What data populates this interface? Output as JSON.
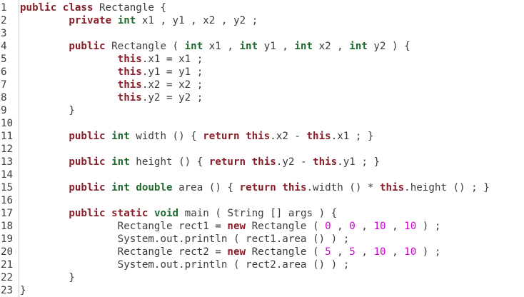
{
  "editor": {
    "lines": [
      {
        "n": "1",
        "tokens": [
          {
            "t": "kw",
            "v": "public"
          },
          {
            "t": "pl",
            "v": " "
          },
          {
            "t": "kw",
            "v": "class"
          },
          {
            "t": "pl",
            "v": " Rectangle {"
          }
        ]
      },
      {
        "n": "2",
        "tokens": [
          {
            "t": "pl",
            "v": "        "
          },
          {
            "t": "kw",
            "v": "private"
          },
          {
            "t": "pl",
            "v": " "
          },
          {
            "t": "ty",
            "v": "int"
          },
          {
            "t": "pl",
            "v": " x1 , y1 , x2 , y2 ;"
          }
        ]
      },
      {
        "n": "3",
        "tokens": []
      },
      {
        "n": "4",
        "tokens": [
          {
            "t": "pl",
            "v": "        "
          },
          {
            "t": "kw",
            "v": "public"
          },
          {
            "t": "pl",
            "v": " Rectangle ( "
          },
          {
            "t": "ty",
            "v": "int"
          },
          {
            "t": "pl",
            "v": " x1 , "
          },
          {
            "t": "ty",
            "v": "int"
          },
          {
            "t": "pl",
            "v": " y1 , "
          },
          {
            "t": "ty",
            "v": "int"
          },
          {
            "t": "pl",
            "v": " x2 , "
          },
          {
            "t": "ty",
            "v": "int"
          },
          {
            "t": "pl",
            "v": " y2 ) {"
          }
        ]
      },
      {
        "n": "5",
        "tokens": [
          {
            "t": "pl",
            "v": "                "
          },
          {
            "t": "kw",
            "v": "this"
          },
          {
            "t": "pl",
            "v": ".x1 = x1 ;"
          }
        ]
      },
      {
        "n": "6",
        "tokens": [
          {
            "t": "pl",
            "v": "                "
          },
          {
            "t": "kw",
            "v": "this"
          },
          {
            "t": "pl",
            "v": ".y1 = y1 ;"
          }
        ]
      },
      {
        "n": "7",
        "tokens": [
          {
            "t": "pl",
            "v": "                "
          },
          {
            "t": "kw",
            "v": "this"
          },
          {
            "t": "pl",
            "v": ".x2 = x2 ;"
          }
        ]
      },
      {
        "n": "8",
        "tokens": [
          {
            "t": "pl",
            "v": "                "
          },
          {
            "t": "kw",
            "v": "this"
          },
          {
            "t": "pl",
            "v": ".y2 = y2 ;"
          }
        ]
      },
      {
        "n": "9",
        "tokens": [
          {
            "t": "pl",
            "v": "        }"
          }
        ]
      },
      {
        "n": "10",
        "tokens": []
      },
      {
        "n": "11",
        "tokens": [
          {
            "t": "pl",
            "v": "        "
          },
          {
            "t": "kw",
            "v": "public"
          },
          {
            "t": "pl",
            "v": " "
          },
          {
            "t": "ty",
            "v": "int"
          },
          {
            "t": "pl",
            "v": " width () { "
          },
          {
            "t": "kw",
            "v": "return"
          },
          {
            "t": "pl",
            "v": " "
          },
          {
            "t": "kw",
            "v": "this"
          },
          {
            "t": "pl",
            "v": ".x2 - "
          },
          {
            "t": "kw",
            "v": "this"
          },
          {
            "t": "pl",
            "v": ".x1 ; }"
          }
        ]
      },
      {
        "n": "12",
        "tokens": []
      },
      {
        "n": "13",
        "tokens": [
          {
            "t": "pl",
            "v": "        "
          },
          {
            "t": "kw",
            "v": "public"
          },
          {
            "t": "pl",
            "v": " "
          },
          {
            "t": "ty",
            "v": "int"
          },
          {
            "t": "pl",
            "v": " height () { "
          },
          {
            "t": "kw",
            "v": "return"
          },
          {
            "t": "pl",
            "v": " "
          },
          {
            "t": "kw",
            "v": "this"
          },
          {
            "t": "pl",
            "v": ".y2 - "
          },
          {
            "t": "kw",
            "v": "this"
          },
          {
            "t": "pl",
            "v": ".y1 ; }"
          }
        ]
      },
      {
        "n": "14",
        "tokens": []
      },
      {
        "n": "15",
        "tokens": [
          {
            "t": "pl",
            "v": "        "
          },
          {
            "t": "kw",
            "v": "public"
          },
          {
            "t": "pl",
            "v": " "
          },
          {
            "t": "ty",
            "v": "int"
          },
          {
            "t": "pl",
            "v": " "
          },
          {
            "t": "ty",
            "v": "double"
          },
          {
            "t": "pl",
            "v": " area () { "
          },
          {
            "t": "kw",
            "v": "return"
          },
          {
            "t": "pl",
            "v": " "
          },
          {
            "t": "kw",
            "v": "this"
          },
          {
            "t": "pl",
            "v": ".width () * "
          },
          {
            "t": "kw",
            "v": "this"
          },
          {
            "t": "pl",
            "v": ".height () ; }"
          }
        ]
      },
      {
        "n": "16",
        "tokens": []
      },
      {
        "n": "17",
        "tokens": [
          {
            "t": "pl",
            "v": "        "
          },
          {
            "t": "kw",
            "v": "public"
          },
          {
            "t": "pl",
            "v": " "
          },
          {
            "t": "kw",
            "v": "static"
          },
          {
            "t": "pl",
            "v": " "
          },
          {
            "t": "ty",
            "v": "void"
          },
          {
            "t": "pl",
            "v": " main ( String [] args ) {"
          }
        ]
      },
      {
        "n": "18",
        "tokens": [
          {
            "t": "pl",
            "v": "                Rectangle rect1 = "
          },
          {
            "t": "kw",
            "v": "new"
          },
          {
            "t": "pl",
            "v": " Rectangle ( "
          },
          {
            "t": "num",
            "v": "0"
          },
          {
            "t": "pl",
            "v": " , "
          },
          {
            "t": "num",
            "v": "0"
          },
          {
            "t": "pl",
            "v": " , "
          },
          {
            "t": "num",
            "v": "10"
          },
          {
            "t": "pl",
            "v": " , "
          },
          {
            "t": "num",
            "v": "10"
          },
          {
            "t": "pl",
            "v": " ) ;"
          }
        ]
      },
      {
        "n": "19",
        "tokens": [
          {
            "t": "pl",
            "v": "                System.out.println ( rect1.area () ) ;"
          }
        ]
      },
      {
        "n": "20",
        "tokens": [
          {
            "t": "pl",
            "v": "                Rectangle rect2 = "
          },
          {
            "t": "kw",
            "v": "new"
          },
          {
            "t": "pl",
            "v": " Rectangle ( "
          },
          {
            "t": "num",
            "v": "5"
          },
          {
            "t": "pl",
            "v": " , "
          },
          {
            "t": "num",
            "v": "5"
          },
          {
            "t": "pl",
            "v": " , "
          },
          {
            "t": "num",
            "v": "10"
          },
          {
            "t": "pl",
            "v": " , "
          },
          {
            "t": "num",
            "v": "10"
          },
          {
            "t": "pl",
            "v": " ) ;"
          }
        ]
      },
      {
        "n": "21",
        "tokens": [
          {
            "t": "pl",
            "v": "                System.out.println ( rect2.area () ) ;"
          }
        ]
      },
      {
        "n": "22",
        "tokens": [
          {
            "t": "pl",
            "v": "        }"
          }
        ]
      },
      {
        "n": "23",
        "tokens": [
          {
            "t": "pl",
            "v": "}"
          }
        ]
      }
    ]
  },
  "colors": {
    "keyword": "#8a1f2a",
    "type": "#1f6b2e",
    "number": "#d000d0",
    "text": "#3c3c3c",
    "background": "#ffffff",
    "gutter_border": "#cfcfcf"
  }
}
